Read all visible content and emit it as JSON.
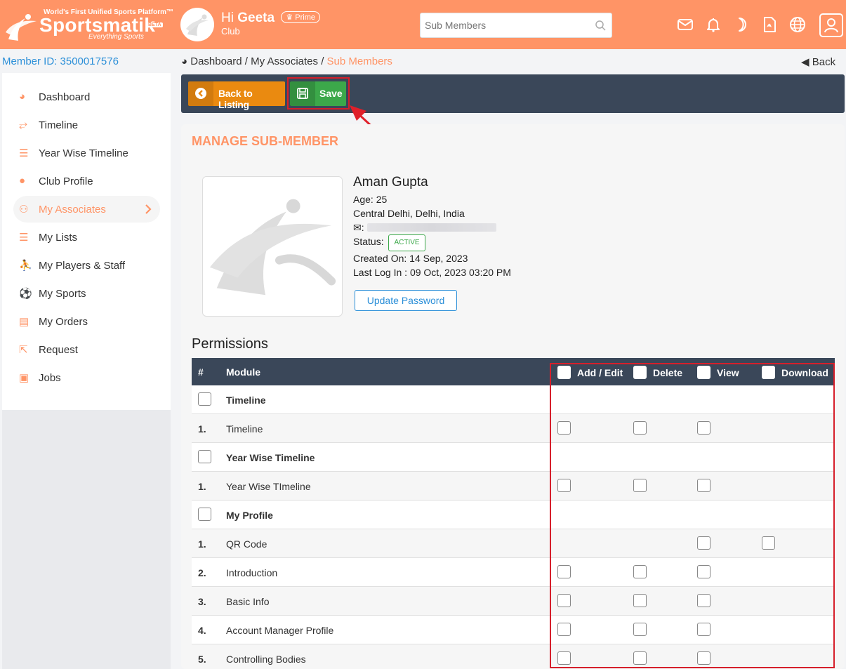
{
  "header": {
    "logo_tagline": "World's First Unified Sports Platform™",
    "logo_name": "Sportsmatik",
    "logo_beta": "BETA",
    "logo_subtitle": "Everything Sports",
    "greeting_prefix": "Hi",
    "user_name": "Geeta",
    "prime_label": "Prime",
    "account_type": "Club",
    "search_placeholder": "Sub Members",
    "icons": [
      "envelope-icon",
      "bell-icon",
      "moon-icon",
      "pdf-icon",
      "globe-icon",
      "user-icon"
    ]
  },
  "subbar": {
    "member_id": "Member ID: 3500017576",
    "breadcrumb": {
      "home": "Dashboard",
      "sep": "/",
      "parent": "My Associates",
      "current": "Sub Members"
    },
    "back_label": "Back"
  },
  "sidebar": {
    "items": [
      {
        "label": "Dashboard"
      },
      {
        "label": "Timeline"
      },
      {
        "label": "Year Wise Timeline"
      },
      {
        "label": "Club Profile"
      },
      {
        "label": "My Associates"
      },
      {
        "label": "My Lists"
      },
      {
        "label": "My Players & Staff"
      },
      {
        "label": "My Sports"
      },
      {
        "label": "My Orders"
      },
      {
        "label": "Request"
      },
      {
        "label": "Jobs"
      }
    ],
    "active_index": 4
  },
  "toolbar": {
    "back_label": "Back to Listing",
    "save_label": "Save"
  },
  "main": {
    "title": "MANAGE SUB-MEMBER",
    "member": {
      "name": "Aman Gupta",
      "age_label": "Age:",
      "age": "25",
      "location": "Central Delhi, Delhi, India",
      "email_label": ":",
      "status_label": "Status:",
      "status": "ACTIVE",
      "created_label": "Created On:",
      "created": "14 Sep, 2023",
      "last_login_label": "Last Log In :",
      "last_login": "09 Oct, 2023 03:20 PM"
    },
    "update_password_label": "Update Password",
    "permissions_title": "Permissions"
  },
  "permissions": {
    "columns": {
      "num": "#",
      "module": "Module",
      "add_edit": "Add / Edit",
      "delete": "Delete",
      "view": "View",
      "download": "Download"
    },
    "rows": [
      {
        "type": "group",
        "module": "Timeline"
      },
      {
        "type": "item",
        "num": "1.",
        "module": "Timeline",
        "add_edit": true,
        "delete": true,
        "view": true,
        "download": false
      },
      {
        "type": "group",
        "module": "Year Wise Timeline"
      },
      {
        "type": "item",
        "num": "1.",
        "module": "Year Wise TImeline",
        "add_edit": true,
        "delete": true,
        "view": true,
        "download": false
      },
      {
        "type": "group",
        "module": "My Profile"
      },
      {
        "type": "item",
        "num": "1.",
        "module": "QR Code",
        "add_edit": false,
        "delete": false,
        "view": true,
        "download": true
      },
      {
        "type": "item",
        "num": "2.",
        "module": "Introduction",
        "add_edit": true,
        "delete": true,
        "view": true,
        "download": false
      },
      {
        "type": "item",
        "num": "3.",
        "module": "Basic Info",
        "add_edit": true,
        "delete": true,
        "view": true,
        "download": false
      },
      {
        "type": "item",
        "num": "4.",
        "module": "Account Manager Profile",
        "add_edit": true,
        "delete": true,
        "view": true,
        "download": false
      },
      {
        "type": "item",
        "num": "5.",
        "module": "Controlling Bodies",
        "add_edit": true,
        "delete": true,
        "view": true,
        "download": false
      }
    ]
  },
  "colors": {
    "brand": "#ff9466",
    "dark_bar": "#3a4759",
    "save_green": "#3ca84a",
    "back_orange": "#ea8a10",
    "link_blue": "#2b8fd8",
    "annotation_red": "#d61f2b"
  }
}
